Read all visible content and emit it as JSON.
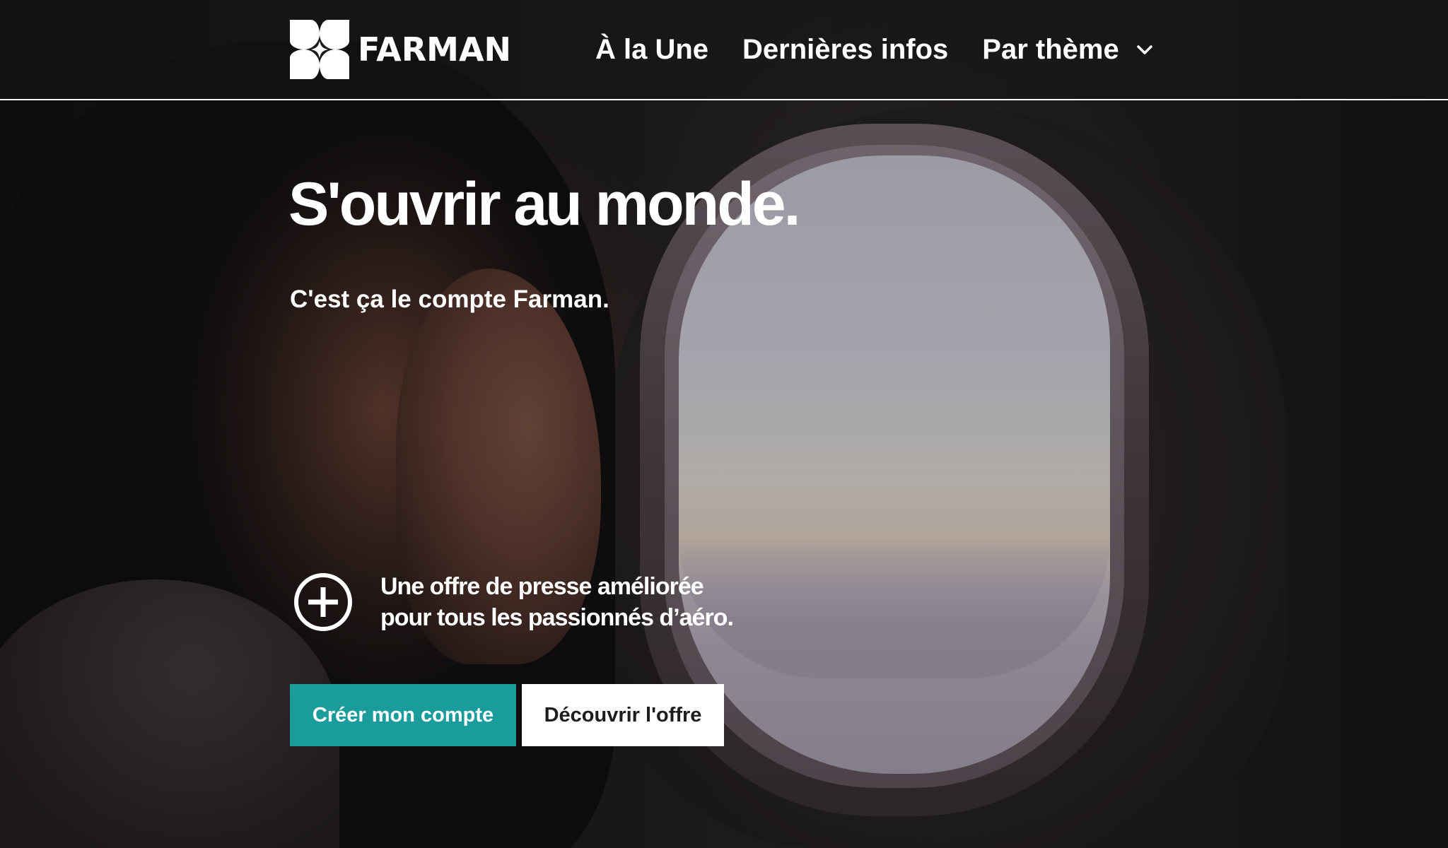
{
  "brand": {
    "name": "FARMAN",
    "accent_color": "#1a9c9c"
  },
  "nav": {
    "items": [
      {
        "label": "À la Une"
      },
      {
        "label": "Dernières infos"
      },
      {
        "label": "Par thème",
        "icon": "chevron-down-icon"
      }
    ]
  },
  "hero": {
    "title": "S'ouvrir au monde.",
    "subtitle": "C'est ça le compte Farman.",
    "offer": {
      "icon": "plus-circle-icon",
      "line1": "Une offre de presse améliorée",
      "line2": "pour tous les passionnés d’aéro."
    },
    "primary_cta": "Créer mon compte",
    "secondary_cta": "Découvrir l'offre"
  }
}
